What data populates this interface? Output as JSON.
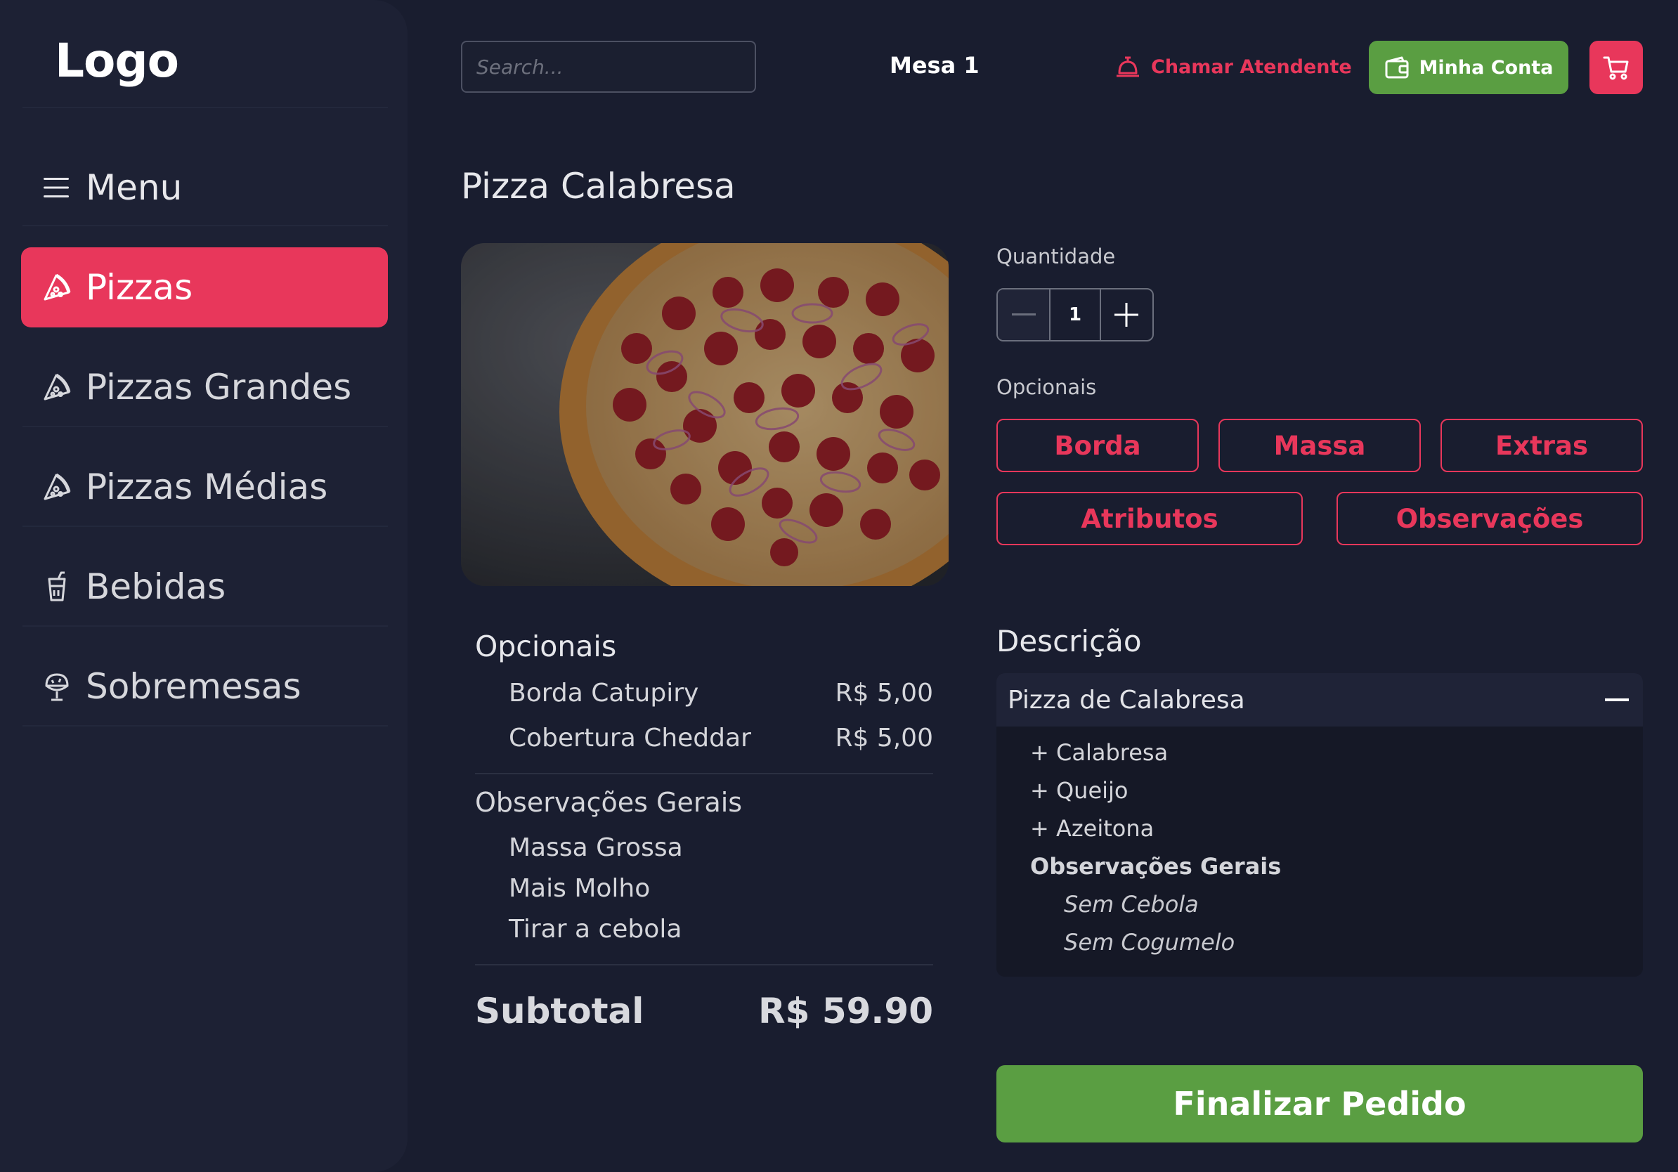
{
  "app": {
    "logo": "Logo"
  },
  "sidebar": {
    "menu_label": "Menu",
    "items": [
      {
        "label": "Pizzas",
        "icon": "pizza-slice-icon",
        "active": true
      },
      {
        "label": "Pizzas Grandes",
        "icon": "pizza-slice-icon",
        "active": false
      },
      {
        "label": "Pizzas Médias",
        "icon": "pizza-slice-icon",
        "active": false
      },
      {
        "label": "Bebidas",
        "icon": "drink-cup-icon",
        "active": false
      },
      {
        "label": "Sobremesas",
        "icon": "ice-cream-icon",
        "active": false
      }
    ]
  },
  "header": {
    "search_placeholder": "Search...",
    "table": "Mesa 1",
    "call_attendant": "Chamar Atendente",
    "account": "Minha Conta",
    "cart_icon": "cart-icon"
  },
  "product": {
    "title": "Pizza Calabresa",
    "image_alt": "pizza-photo",
    "quantity_label": "Quantidade",
    "quantity": "1",
    "options_label": "Opcionais",
    "option_buttons": [
      "Borda",
      "Massa",
      "Extras",
      "Atributos",
      "Observações"
    ]
  },
  "summary": {
    "options_title": "Opcionais",
    "options": [
      {
        "name": "Borda Catupiry",
        "price": "R$ 5,00"
      },
      {
        "name": "Cobertura Cheddar",
        "price": "R$ 5,00"
      }
    ],
    "obs_title": "Observações Gerais",
    "obs": [
      "Massa Grossa",
      "Mais Molho",
      "Tirar a cebola"
    ],
    "subtotal_label": "Subtotal",
    "subtotal_value": "R$ 59.90"
  },
  "description": {
    "title": "Descrição",
    "item": "Pizza de Calabresa",
    "ingredients": [
      "+ Calabresa",
      "+ Queijo",
      "+ Azeitona"
    ],
    "obs_title": "Observações Gerais",
    "obs": [
      "Sem Cebola",
      "Sem Cogumelo"
    ]
  },
  "actions": {
    "finish": "Finalizar Pedido"
  },
  "colors": {
    "accent": "#e8375b",
    "success": "#5a9e42",
    "background": "#191d2f",
    "sidebar": "#1d2134"
  }
}
